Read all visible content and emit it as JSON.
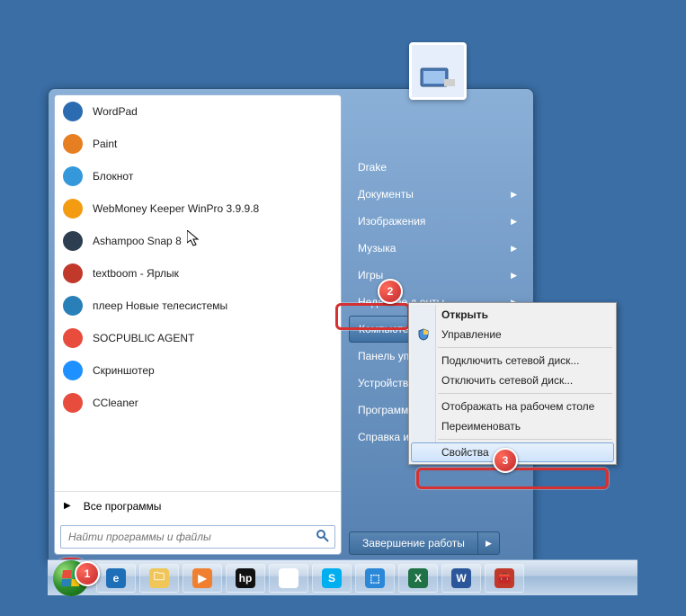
{
  "programs": [
    {
      "label": "WordPad",
      "iconColor": "#2b6cb0"
    },
    {
      "label": "Paint",
      "iconColor": "#e67e22"
    },
    {
      "label": "Блокнот",
      "iconColor": "#3498db"
    },
    {
      "label": "WebMoney Keeper WinPro 3.9.9.8",
      "iconColor": "#f39c12"
    },
    {
      "label": "Ashampoo Snap 8",
      "iconColor": "#2c3e50"
    },
    {
      "label": "textboom - Ярлык",
      "iconColor": "#c0392b"
    },
    {
      "label": "плеер Новые телесистемы",
      "iconColor": "#2980b9"
    },
    {
      "label": "SOCPUBLIC AGENT",
      "iconColor": "#e74c3c"
    },
    {
      "label": "Скриншотер",
      "iconColor": "#1e90ff"
    },
    {
      "label": "CCleaner",
      "iconColor": "#e74c3c"
    }
  ],
  "all_programs_label": "Все программы",
  "search_placeholder": "Найти программы и файлы",
  "right_items": [
    {
      "label": "Drake",
      "sub": false
    },
    {
      "label": "Документы",
      "sub": true
    },
    {
      "label": "Изображения",
      "sub": true
    },
    {
      "label": "Музыка",
      "sub": true
    },
    {
      "label": "Игры",
      "sub": true
    },
    {
      "label": "Недавние документы",
      "sub": true,
      "truncated": "Недавние д          енты"
    },
    {
      "label": "Компьютер",
      "sub": true,
      "selected": true
    },
    {
      "label": "Панель управления",
      "truncated": "Панель упр",
      "sub": false
    },
    {
      "label": "Устройства и принтеры",
      "truncated": "Устройства",
      "sub": false
    },
    {
      "label": "Программы по умолчанию",
      "truncated": "Программы",
      "sub": false
    },
    {
      "label": "Справка и поддержка",
      "truncated": "Справка и п",
      "sub": false
    }
  ],
  "shutdown_label": "Завершение работы",
  "context": [
    {
      "label": "Открыть",
      "bold": true
    },
    {
      "label": "Управление",
      "icon": "shield"
    },
    {
      "sep": true
    },
    {
      "label": "Подключить сетевой диск..."
    },
    {
      "label": "Отключить сетевой диск..."
    },
    {
      "sep": true
    },
    {
      "label": "Отображать на рабочем столе"
    },
    {
      "label": "Переименовать"
    },
    {
      "sep": true
    },
    {
      "label": "Свойства",
      "hover": true
    }
  ],
  "badges": {
    "b1": "1",
    "b2": "2",
    "b3": "3"
  },
  "taskbar": [
    {
      "name": "ie-icon",
      "color": "#1e6fb8",
      "glyph": "e"
    },
    {
      "name": "explorer-icon",
      "color": "#f0c659",
      "glyph": "🗀"
    },
    {
      "name": "wmp-icon",
      "color": "#f08030",
      "glyph": "▶"
    },
    {
      "name": "hp-icon",
      "color": "#111",
      "glyph": "hp"
    },
    {
      "name": "chrome-icon",
      "color": "#fff",
      "glyph": "◉"
    },
    {
      "name": "skype-icon",
      "color": "#00aff0",
      "glyph": "S"
    },
    {
      "name": "app-blue-icon",
      "color": "#2b88d8",
      "glyph": "⬚"
    },
    {
      "name": "excel-icon",
      "color": "#1f7246",
      "glyph": "X"
    },
    {
      "name": "word-icon",
      "color": "#2b579a",
      "glyph": "W"
    },
    {
      "name": "toolbox-icon",
      "color": "#c0392b",
      "glyph": "🧰"
    }
  ]
}
